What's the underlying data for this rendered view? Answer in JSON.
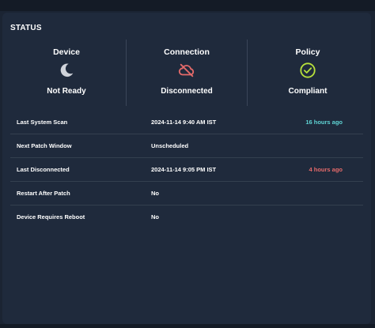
{
  "panel": {
    "title": "STATUS"
  },
  "status": {
    "device": {
      "heading": "Device",
      "value": "Not Ready",
      "icon": "moon-icon",
      "icon_color": "#cfd3da"
    },
    "connection": {
      "heading": "Connection",
      "value": "Disconnected",
      "icon": "cloud-off-icon",
      "icon_color": "#e46a6a"
    },
    "policy": {
      "heading": "Policy",
      "value": "Compliant",
      "icon": "check-circle-icon",
      "icon_color": "#b7e03b"
    }
  },
  "details": [
    {
      "label": "Last System Scan",
      "value": "2024-11-14 9:40 AM IST",
      "relative": "16 hours ago",
      "relative_color": "#5fd4d4"
    },
    {
      "label": "Next Patch Window",
      "value": "Unscheduled",
      "relative": ""
    },
    {
      "label": "Last Disconnected",
      "value": "2024-11-14 9:05 PM IST",
      "relative": "4 hours ago",
      "relative_color": "#e46a6a"
    },
    {
      "label": "Restart After Patch",
      "value": "No",
      "relative": ""
    },
    {
      "label": "Device Requires Reboot",
      "value": "No",
      "relative": ""
    }
  ]
}
